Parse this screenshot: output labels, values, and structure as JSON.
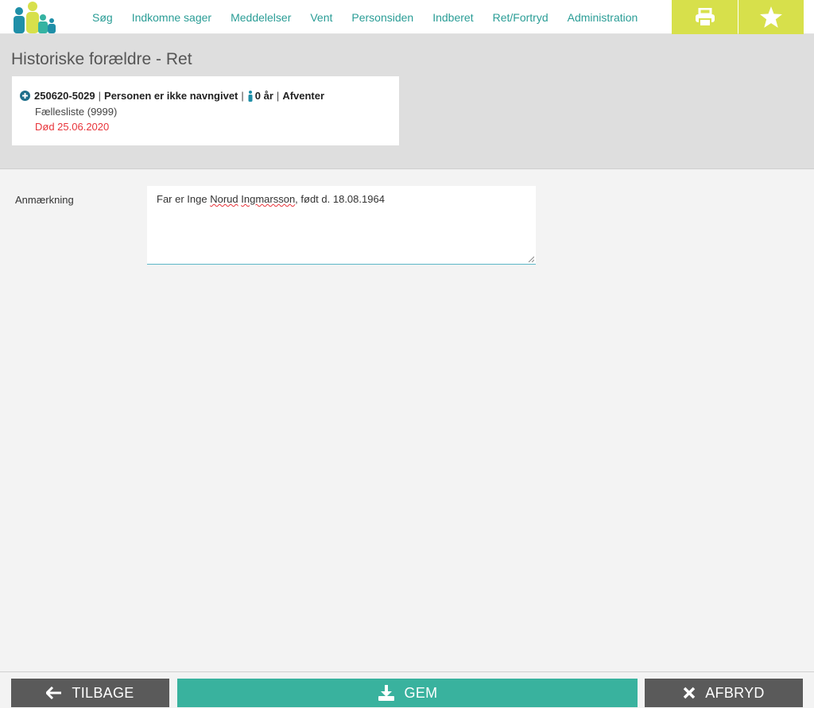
{
  "nav": {
    "items": [
      "Søg",
      "Indkomne sager",
      "Meddelelser",
      "Vent",
      "Personsiden",
      "Indberet",
      "Ret/Fortryd",
      "Administration"
    ]
  },
  "header": {
    "title": "Historiske forældre - Ret"
  },
  "person": {
    "cpr": "250620-5029",
    "name": "Personen er ikke navngivet",
    "age": "0 år",
    "status": "Afventer",
    "list": "Fællesliste (9999)",
    "death": "Død 25.06.2020"
  },
  "form": {
    "label": "Anmærkning",
    "remark_before": "Far er Inge ",
    "remark_word1": "Norud",
    "remark_space": " ",
    "remark_word2": "Ingmarsson",
    "remark_after": ", født d. 18.08.1964"
  },
  "footer": {
    "back_label": "TILBAGE",
    "save_label": "GEM",
    "cancel_label": "AFBRYD"
  },
  "colors": {
    "accent": "#2a9d96",
    "tool": "#d7e04b",
    "save": "#39b29e",
    "dark_button": "#5a5a5a",
    "death": "#e8343a"
  },
  "icons": [
    "logo-icon",
    "print-icon",
    "star-icon",
    "plus-circle-icon",
    "person-icon",
    "arrow-left-icon",
    "download-icon",
    "close-icon"
  ]
}
